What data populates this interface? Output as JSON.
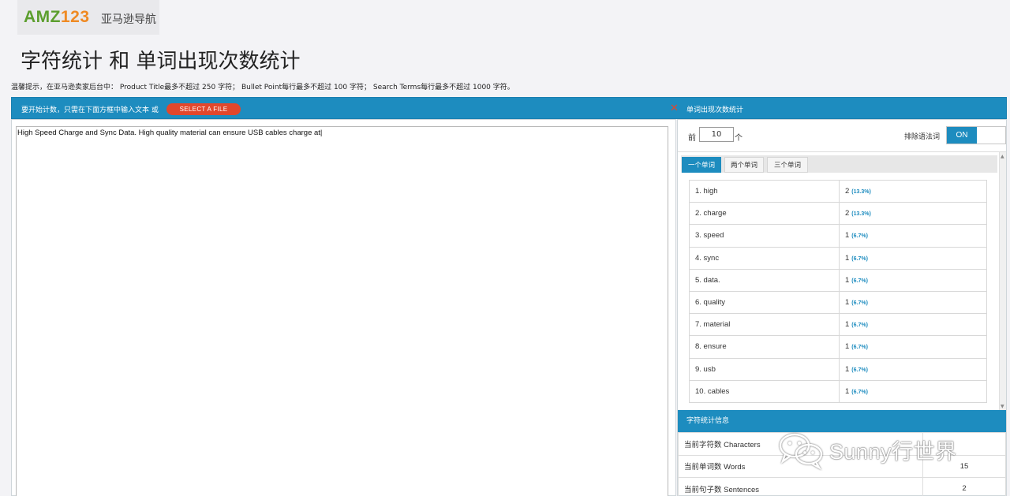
{
  "logo": {
    "brand_green": "AMZ",
    "brand_orange": "123",
    "subtitle": "亚马逊导航"
  },
  "page_title": "字符统计 和 单词出现次数统计",
  "tips": "温馨提示，在亚马逊卖家后台中： Product Title最多不超过 250 字符； Bullet Point每行最多不超过 100 字符； Search Terms每行最多不超过 1000 字符。",
  "left_header": {
    "text": "要开始计数，只需在下面方框中输入文本 或",
    "select_label": "SELECT A FILE"
  },
  "text_input": {
    "value": "High Speed Charge and Sync Data. High quality material can ensure USB cables charge at|"
  },
  "right_header": {
    "close_icon": "✕",
    "title": "单词出现次数统计"
  },
  "controls": {
    "prefix": "前",
    "top_n": "10",
    "suffix": "个",
    "exclude_label": "排除语法词",
    "toggle_label": "ON"
  },
  "tabs": [
    "一个单词",
    "两个单词",
    "三个单词"
  ],
  "words": [
    {
      "word": "1. high",
      "count": "2",
      "pct": "(13.3%)"
    },
    {
      "word": "2. charge",
      "count": "2",
      "pct": "(13.3%)"
    },
    {
      "word": "3. speed",
      "count": "1",
      "pct": "(6.7%)"
    },
    {
      "word": "4. sync",
      "count": "1",
      "pct": "(6.7%)"
    },
    {
      "word": "5. data.",
      "count": "1",
      "pct": "(6.7%)"
    },
    {
      "word": "6. quality",
      "count": "1",
      "pct": "(6.7%)"
    },
    {
      "word": "7. material",
      "count": "1",
      "pct": "(6.7%)"
    },
    {
      "word": "8. ensure",
      "count": "1",
      "pct": "(6.7%)"
    },
    {
      "word": "9. usb",
      "count": "1",
      "pct": "(6.7%)"
    },
    {
      "word": "10. cables",
      "count": "1",
      "pct": "(6.7%)"
    }
  ],
  "stats": {
    "title": "字符统计信息",
    "rows": [
      {
        "label": "当前字符数 Characters",
        "value": ""
      },
      {
        "label": "当前单词数 Words",
        "value": "15"
      },
      {
        "label": "当前句子数 Sentences",
        "value": "2"
      }
    ]
  },
  "watermark": {
    "text": "Sunny行世界"
  },
  "colors": {
    "accent": "#1d8cbf",
    "select_button": "#e2472c",
    "brand_green": "#5c9e2e",
    "brand_orange": "#ef8a23"
  }
}
